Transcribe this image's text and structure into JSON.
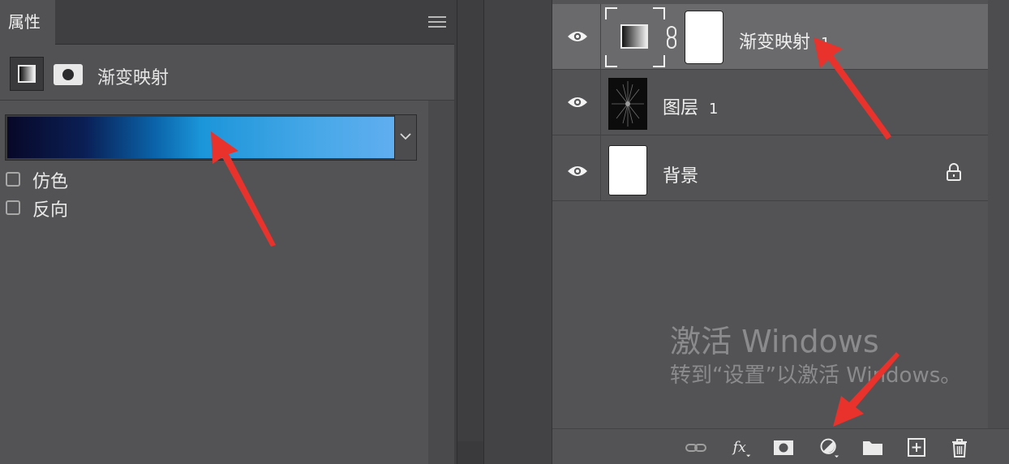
{
  "properties": {
    "tab_label": "属性",
    "menu_icon": "hamburger-menu-icon",
    "adjustment_icon": "gradient-map-icon",
    "mask_icon": "layer-mask-icon",
    "title": "渐变映射",
    "gradient": {
      "colors": [
        "#080828",
        "#0a1f55",
        "#0b63a9",
        "#1b95d9",
        "#48a8e8",
        "#60aef0"
      ],
      "dropdown_icon": "chevron-down-icon"
    },
    "dither_label": "仿色",
    "dither_checked": false,
    "reverse_label": "反向",
    "reverse_checked": false
  },
  "layers": [
    {
      "name": "渐变映射",
      "suffix": "1",
      "type": "adjustment",
      "selected": true,
      "visible": true
    },
    {
      "name": "图层",
      "suffix": "1",
      "type": "pixel",
      "selected": false,
      "visible": true
    },
    {
      "name": "背景",
      "suffix": "",
      "type": "background",
      "selected": false,
      "visible": true,
      "locked": true
    }
  ],
  "watermark": {
    "line1": "激活 Windows",
    "line2": "转到“设置”以激活 Windows。"
  },
  "footer_buttons": [
    "link-layers-icon",
    "fx-layer-style-icon",
    "add-mask-icon",
    "new-adjustment-layer-icon",
    "new-group-folder-icon",
    "new-layer-icon",
    "delete-trash-icon"
  ],
  "colors": {
    "annotation_arrow": "#e8322b",
    "panel_bg": "#535355",
    "selected_row": "#6a6a6c"
  }
}
